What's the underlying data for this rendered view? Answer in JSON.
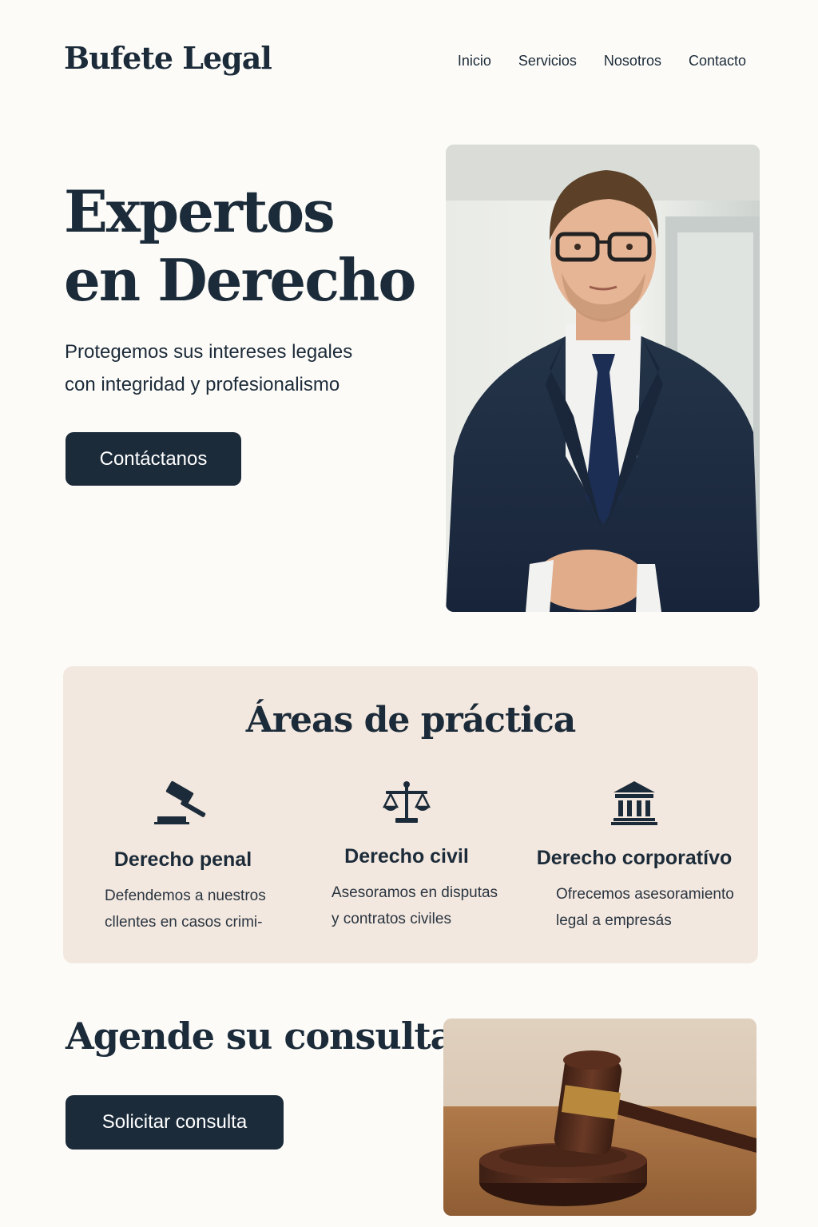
{
  "header": {
    "brand": "Bufete Legal",
    "nav": [
      "Inicio",
      "Servicios",
      "Nosotros",
      "Contacto"
    ]
  },
  "hero": {
    "title_line1": "Expertos",
    "title_line2": "en Derecho",
    "subtitle_line1": "Protegemos sus intereses legales",
    "subtitle_line2": "con integridad y profesionalismo",
    "cta": "Contáctanos",
    "photo": "lawyer-portrait"
  },
  "practice": {
    "title": "Áreas de práctica",
    "areas": [
      {
        "icon": "gavel-icon",
        "title": "Derecho penal",
        "line1": "Defendemos a nuestros",
        "line2": "cllentes en casos crimi-"
      },
      {
        "icon": "scales-icon",
        "title": "Derecho civil",
        "line1": "Asesoramos en disputas",
        "line2": "y contratos civiles"
      },
      {
        "icon": "courthouse-icon",
        "title": "Derecho corporatívo",
        "line1": "Ofrecemos asesoramiento",
        "line2": "legal a empresás"
      }
    ]
  },
  "consult": {
    "title": "Agende su consulta",
    "cta": "Solicitar consulta",
    "photo": "gavel-photo"
  },
  "colors": {
    "navy": "#1b2b3a",
    "background": "#fcfbf8",
    "panel": "#f3e8df"
  }
}
